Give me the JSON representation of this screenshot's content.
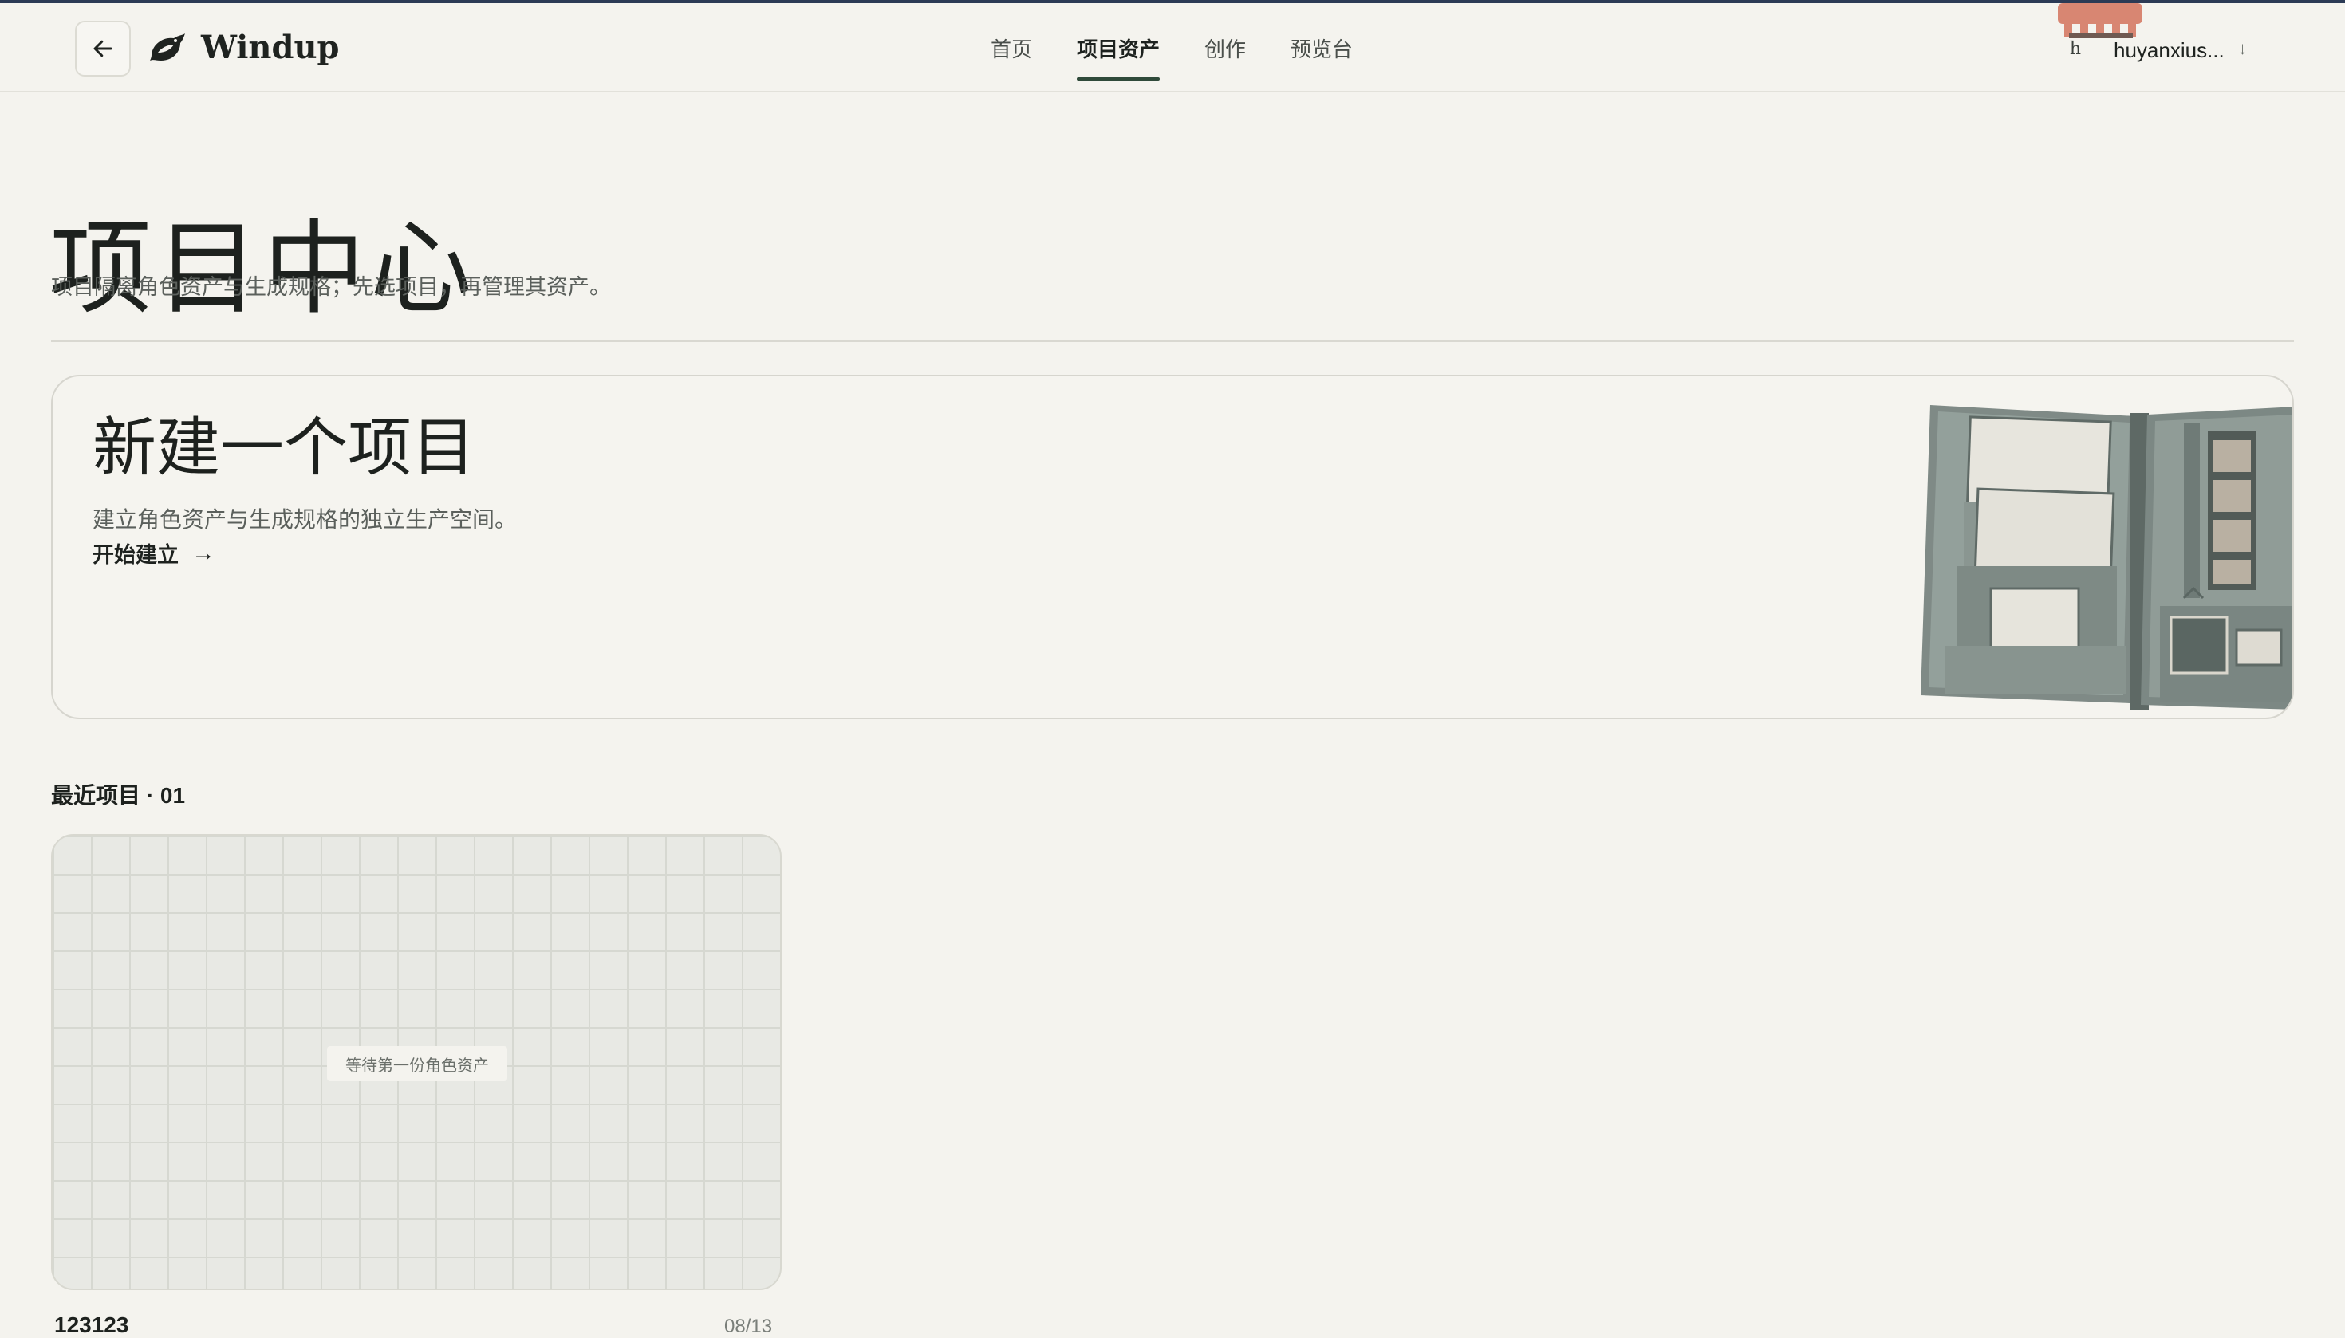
{
  "header": {
    "brand": "Windup",
    "nav": [
      {
        "label": "首页",
        "active": false
      },
      {
        "label": "项目资产",
        "active": true
      },
      {
        "label": "创作",
        "active": false
      },
      {
        "label": "预览台",
        "active": false
      }
    ],
    "user": {
      "initial": "h",
      "name": "huyanxius...",
      "caret": "↓"
    }
  },
  "page": {
    "title": "项目中心",
    "subtitle": "项目隔离角色资产与生成规格；先选项目，再管理其资产。"
  },
  "new_project": {
    "title": "新建一个项目",
    "description": "建立角色资产与生成规格的独立生产空间。",
    "cta": "开始建立",
    "cta_icon": "→"
  },
  "recent": {
    "title": "最近项目 · 01",
    "projects": [
      {
        "name": "123123",
        "date": "08/13",
        "placeholder": "等待第一份角色资产"
      }
    ]
  },
  "colors": {
    "background": "#f4f3ee",
    "accent": "#2f4a3a",
    "top_bar": "#2b3a55"
  }
}
